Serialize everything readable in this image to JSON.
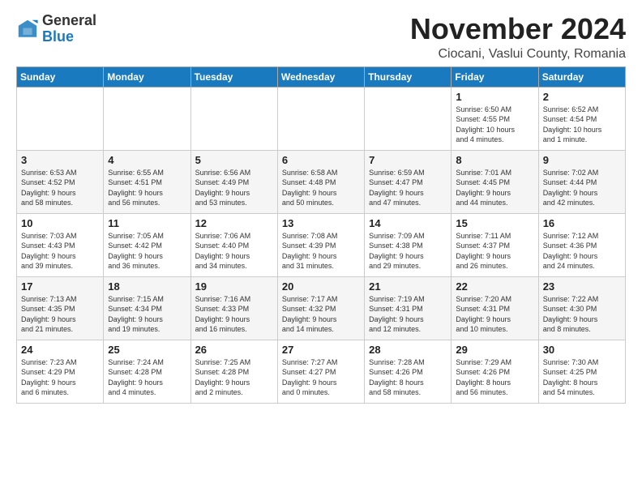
{
  "logo": {
    "general": "General",
    "blue": "Blue"
  },
  "header": {
    "month": "November 2024",
    "location": "Ciocani, Vaslui County, Romania"
  },
  "days_of_week": [
    "Sunday",
    "Monday",
    "Tuesday",
    "Wednesday",
    "Thursday",
    "Friday",
    "Saturday"
  ],
  "weeks": [
    [
      {
        "day": "",
        "info": ""
      },
      {
        "day": "",
        "info": ""
      },
      {
        "day": "",
        "info": ""
      },
      {
        "day": "",
        "info": ""
      },
      {
        "day": "",
        "info": ""
      },
      {
        "day": "1",
        "info": "Sunrise: 6:50 AM\nSunset: 4:55 PM\nDaylight: 10 hours\nand 4 minutes."
      },
      {
        "day": "2",
        "info": "Sunrise: 6:52 AM\nSunset: 4:54 PM\nDaylight: 10 hours\nand 1 minute."
      }
    ],
    [
      {
        "day": "3",
        "info": "Sunrise: 6:53 AM\nSunset: 4:52 PM\nDaylight: 9 hours\nand 58 minutes."
      },
      {
        "day": "4",
        "info": "Sunrise: 6:55 AM\nSunset: 4:51 PM\nDaylight: 9 hours\nand 56 minutes."
      },
      {
        "day": "5",
        "info": "Sunrise: 6:56 AM\nSunset: 4:49 PM\nDaylight: 9 hours\nand 53 minutes."
      },
      {
        "day": "6",
        "info": "Sunrise: 6:58 AM\nSunset: 4:48 PM\nDaylight: 9 hours\nand 50 minutes."
      },
      {
        "day": "7",
        "info": "Sunrise: 6:59 AM\nSunset: 4:47 PM\nDaylight: 9 hours\nand 47 minutes."
      },
      {
        "day": "8",
        "info": "Sunrise: 7:01 AM\nSunset: 4:45 PM\nDaylight: 9 hours\nand 44 minutes."
      },
      {
        "day": "9",
        "info": "Sunrise: 7:02 AM\nSunset: 4:44 PM\nDaylight: 9 hours\nand 42 minutes."
      }
    ],
    [
      {
        "day": "10",
        "info": "Sunrise: 7:03 AM\nSunset: 4:43 PM\nDaylight: 9 hours\nand 39 minutes."
      },
      {
        "day": "11",
        "info": "Sunrise: 7:05 AM\nSunset: 4:42 PM\nDaylight: 9 hours\nand 36 minutes."
      },
      {
        "day": "12",
        "info": "Sunrise: 7:06 AM\nSunset: 4:40 PM\nDaylight: 9 hours\nand 34 minutes."
      },
      {
        "day": "13",
        "info": "Sunrise: 7:08 AM\nSunset: 4:39 PM\nDaylight: 9 hours\nand 31 minutes."
      },
      {
        "day": "14",
        "info": "Sunrise: 7:09 AM\nSunset: 4:38 PM\nDaylight: 9 hours\nand 29 minutes."
      },
      {
        "day": "15",
        "info": "Sunrise: 7:11 AM\nSunset: 4:37 PM\nDaylight: 9 hours\nand 26 minutes."
      },
      {
        "day": "16",
        "info": "Sunrise: 7:12 AM\nSunset: 4:36 PM\nDaylight: 9 hours\nand 24 minutes."
      }
    ],
    [
      {
        "day": "17",
        "info": "Sunrise: 7:13 AM\nSunset: 4:35 PM\nDaylight: 9 hours\nand 21 minutes."
      },
      {
        "day": "18",
        "info": "Sunrise: 7:15 AM\nSunset: 4:34 PM\nDaylight: 9 hours\nand 19 minutes."
      },
      {
        "day": "19",
        "info": "Sunrise: 7:16 AM\nSunset: 4:33 PM\nDaylight: 9 hours\nand 16 minutes."
      },
      {
        "day": "20",
        "info": "Sunrise: 7:17 AM\nSunset: 4:32 PM\nDaylight: 9 hours\nand 14 minutes."
      },
      {
        "day": "21",
        "info": "Sunrise: 7:19 AM\nSunset: 4:31 PM\nDaylight: 9 hours\nand 12 minutes."
      },
      {
        "day": "22",
        "info": "Sunrise: 7:20 AM\nSunset: 4:31 PM\nDaylight: 9 hours\nand 10 minutes."
      },
      {
        "day": "23",
        "info": "Sunrise: 7:22 AM\nSunset: 4:30 PM\nDaylight: 9 hours\nand 8 minutes."
      }
    ],
    [
      {
        "day": "24",
        "info": "Sunrise: 7:23 AM\nSunset: 4:29 PM\nDaylight: 9 hours\nand 6 minutes."
      },
      {
        "day": "25",
        "info": "Sunrise: 7:24 AM\nSunset: 4:28 PM\nDaylight: 9 hours\nand 4 minutes."
      },
      {
        "day": "26",
        "info": "Sunrise: 7:25 AM\nSunset: 4:28 PM\nDaylight: 9 hours\nand 2 minutes."
      },
      {
        "day": "27",
        "info": "Sunrise: 7:27 AM\nSunset: 4:27 PM\nDaylight: 9 hours\nand 0 minutes."
      },
      {
        "day": "28",
        "info": "Sunrise: 7:28 AM\nSunset: 4:26 PM\nDaylight: 8 hours\nand 58 minutes."
      },
      {
        "day": "29",
        "info": "Sunrise: 7:29 AM\nSunset: 4:26 PM\nDaylight: 8 hours\nand 56 minutes."
      },
      {
        "day": "30",
        "info": "Sunrise: 7:30 AM\nSunset: 4:25 PM\nDaylight: 8 hours\nand 54 minutes."
      }
    ]
  ]
}
